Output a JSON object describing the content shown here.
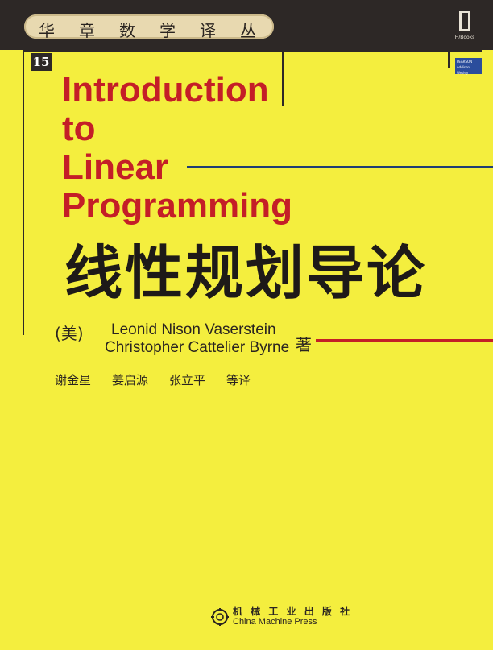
{
  "series": {
    "name_chars": [
      "华",
      "章",
      "数",
      "学",
      "译",
      "丛"
    ],
    "volume_number": "15"
  },
  "publisher_logo": {
    "caption": "H/Books"
  },
  "pearson_badge": {
    "lines": [
      "PEARSON",
      "Addison",
      "Wesley"
    ]
  },
  "book": {
    "title_en_lines": [
      "Introduction",
      "to",
      "Linear",
      "Programming"
    ],
    "title_cn": "线性规划导论",
    "nationality": "(美)",
    "authors": [
      "Leonid Nison Vaserstein",
      "Christopher Cattelier Byrne"
    ],
    "author_suffix": "著",
    "translators": [
      "谢金星",
      "姜启源",
      "张立平",
      "等译"
    ]
  },
  "publisher": {
    "name_cn": "机 械 工 业 出 版 社",
    "name_en": "China Machine Press"
  },
  "colors": {
    "cover_yellow": "#f4ee3e",
    "title_red": "#c41e27",
    "band_dark": "#2d2826",
    "accent_line_blue": "#1f3d73",
    "accent_line_red": "#c41e27",
    "pearson_blue": "#2b4d9c"
  }
}
